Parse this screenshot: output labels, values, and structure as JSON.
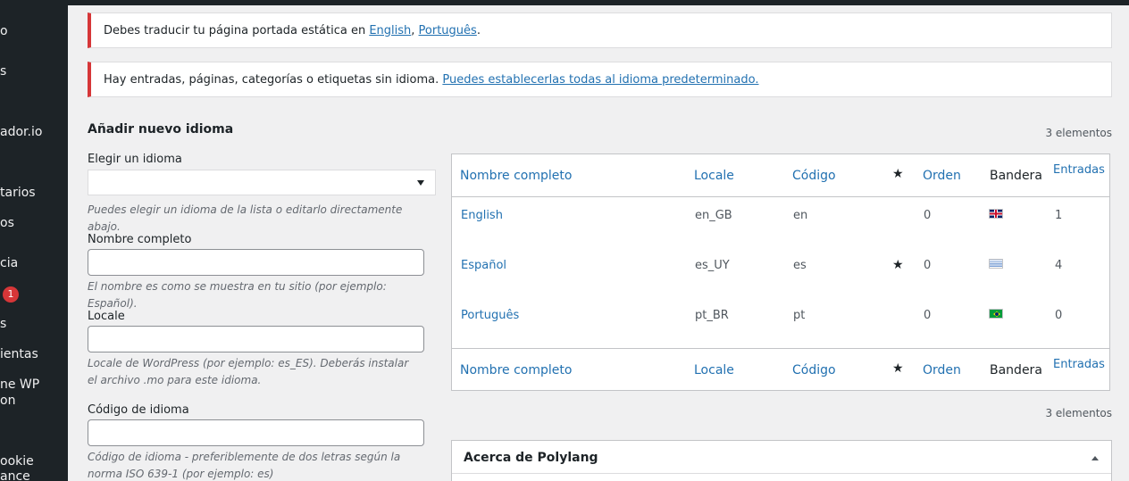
{
  "sidebar": {
    "items": [
      {
        "label": "o"
      },
      {
        "label": "s"
      },
      {
        "label": "ador.io"
      },
      {
        "label": "tarios"
      },
      {
        "label": "os"
      },
      {
        "label": "cia"
      },
      {
        "label": "",
        "badge": "1"
      },
      {
        "label": "s"
      },
      {
        "label": "ientas"
      },
      {
        "label": "ne WP"
      },
      {
        "label": "on"
      },
      {
        "label": "ookie"
      },
      {
        "label": "ance"
      }
    ]
  },
  "notices": {
    "translate": {
      "text": "Debes traducir tu página portada estática en ",
      "link1": "English",
      "sep": ", ",
      "link2": "Português",
      "end": "."
    },
    "no_language": {
      "text": "Hay entradas, páginas, categorías o etiquetas sin idioma. ",
      "link": "Puedes establecerlas todas al idioma predeterminado."
    }
  },
  "form": {
    "title": "Añadir nuevo idioma",
    "choose_label": "Elegir un idioma",
    "choose_value": "",
    "choose_help": "Puedes elegir un idioma de la lista o editarlo directamente abajo.",
    "name_label": "Nombre completo",
    "name_value": "",
    "name_help": "El nombre es como se muestra en tu sitio (por ejemplo: Español).",
    "locale_label": "Locale",
    "locale_value": "",
    "locale_help": "Locale de WordPress (por ejemplo: es_ES). Deberás instalar el archivo .mo para este idioma.",
    "code_label": "Código de idioma",
    "code_value": "",
    "code_help": "Código de idioma - preferiblemente de dos letras según la norma ISO 639-1 (por ejemplo: es)"
  },
  "table": {
    "count_top": "3 elementos",
    "count_bottom": "3 elementos",
    "columns": {
      "name": "Nombre completo",
      "locale": "Locale",
      "code": "Código",
      "default": "★",
      "order": "Orden",
      "flag": "Bandera",
      "posts": "Entradas"
    },
    "rows": [
      {
        "name": "English",
        "locale": "en_GB",
        "code": "en",
        "default": "",
        "order": "0",
        "flag": "flag-gb-icon",
        "posts": "1"
      },
      {
        "name": "Español",
        "locale": "es_UY",
        "code": "es",
        "default": "★",
        "order": "0",
        "flag": "flag-uy-icon",
        "posts": "4"
      },
      {
        "name": "Português",
        "locale": "pt_BR",
        "code": "pt",
        "default": "",
        "order": "0",
        "flag": "flag-br-icon",
        "posts": "0"
      }
    ]
  },
  "about": {
    "title": "Acerca de Polylang"
  },
  "colors": {
    "accent": "#2271b1",
    "error": "#d63638",
    "sidebar": "#1d2327"
  }
}
